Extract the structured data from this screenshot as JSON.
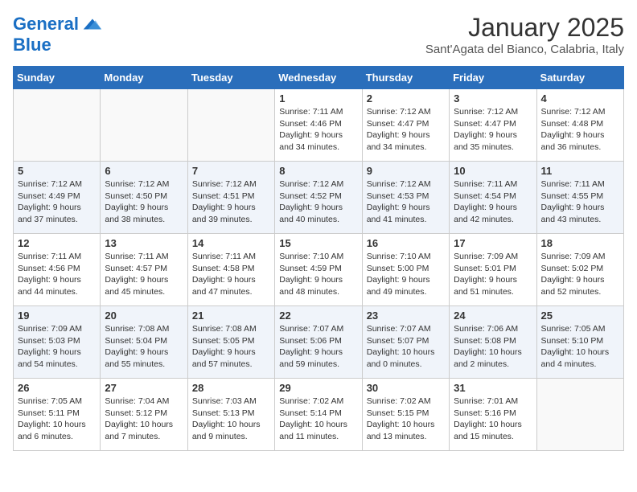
{
  "header": {
    "logo_line1": "General",
    "logo_line2": "Blue",
    "month": "January 2025",
    "location": "Sant'Agata del Bianco, Calabria, Italy"
  },
  "weekdays": [
    "Sunday",
    "Monday",
    "Tuesday",
    "Wednesday",
    "Thursday",
    "Friday",
    "Saturday"
  ],
  "weeks": [
    [
      {
        "day": "",
        "info": ""
      },
      {
        "day": "",
        "info": ""
      },
      {
        "day": "",
        "info": ""
      },
      {
        "day": "1",
        "info": "Sunrise: 7:11 AM\nSunset: 4:46 PM\nDaylight: 9 hours\nand 34 minutes."
      },
      {
        "day": "2",
        "info": "Sunrise: 7:12 AM\nSunset: 4:47 PM\nDaylight: 9 hours\nand 34 minutes."
      },
      {
        "day": "3",
        "info": "Sunrise: 7:12 AM\nSunset: 4:47 PM\nDaylight: 9 hours\nand 35 minutes."
      },
      {
        "day": "4",
        "info": "Sunrise: 7:12 AM\nSunset: 4:48 PM\nDaylight: 9 hours\nand 36 minutes."
      }
    ],
    [
      {
        "day": "5",
        "info": "Sunrise: 7:12 AM\nSunset: 4:49 PM\nDaylight: 9 hours\nand 37 minutes."
      },
      {
        "day": "6",
        "info": "Sunrise: 7:12 AM\nSunset: 4:50 PM\nDaylight: 9 hours\nand 38 minutes."
      },
      {
        "day": "7",
        "info": "Sunrise: 7:12 AM\nSunset: 4:51 PM\nDaylight: 9 hours\nand 39 minutes."
      },
      {
        "day": "8",
        "info": "Sunrise: 7:12 AM\nSunset: 4:52 PM\nDaylight: 9 hours\nand 40 minutes."
      },
      {
        "day": "9",
        "info": "Sunrise: 7:12 AM\nSunset: 4:53 PM\nDaylight: 9 hours\nand 41 minutes."
      },
      {
        "day": "10",
        "info": "Sunrise: 7:11 AM\nSunset: 4:54 PM\nDaylight: 9 hours\nand 42 minutes."
      },
      {
        "day": "11",
        "info": "Sunrise: 7:11 AM\nSunset: 4:55 PM\nDaylight: 9 hours\nand 43 minutes."
      }
    ],
    [
      {
        "day": "12",
        "info": "Sunrise: 7:11 AM\nSunset: 4:56 PM\nDaylight: 9 hours\nand 44 minutes."
      },
      {
        "day": "13",
        "info": "Sunrise: 7:11 AM\nSunset: 4:57 PM\nDaylight: 9 hours\nand 45 minutes."
      },
      {
        "day": "14",
        "info": "Sunrise: 7:11 AM\nSunset: 4:58 PM\nDaylight: 9 hours\nand 47 minutes."
      },
      {
        "day": "15",
        "info": "Sunrise: 7:10 AM\nSunset: 4:59 PM\nDaylight: 9 hours\nand 48 minutes."
      },
      {
        "day": "16",
        "info": "Sunrise: 7:10 AM\nSunset: 5:00 PM\nDaylight: 9 hours\nand 49 minutes."
      },
      {
        "day": "17",
        "info": "Sunrise: 7:09 AM\nSunset: 5:01 PM\nDaylight: 9 hours\nand 51 minutes."
      },
      {
        "day": "18",
        "info": "Sunrise: 7:09 AM\nSunset: 5:02 PM\nDaylight: 9 hours\nand 52 minutes."
      }
    ],
    [
      {
        "day": "19",
        "info": "Sunrise: 7:09 AM\nSunset: 5:03 PM\nDaylight: 9 hours\nand 54 minutes."
      },
      {
        "day": "20",
        "info": "Sunrise: 7:08 AM\nSunset: 5:04 PM\nDaylight: 9 hours\nand 55 minutes."
      },
      {
        "day": "21",
        "info": "Sunrise: 7:08 AM\nSunset: 5:05 PM\nDaylight: 9 hours\nand 57 minutes."
      },
      {
        "day": "22",
        "info": "Sunrise: 7:07 AM\nSunset: 5:06 PM\nDaylight: 9 hours\nand 59 minutes."
      },
      {
        "day": "23",
        "info": "Sunrise: 7:07 AM\nSunset: 5:07 PM\nDaylight: 10 hours\nand 0 minutes."
      },
      {
        "day": "24",
        "info": "Sunrise: 7:06 AM\nSunset: 5:08 PM\nDaylight: 10 hours\nand 2 minutes."
      },
      {
        "day": "25",
        "info": "Sunrise: 7:05 AM\nSunset: 5:10 PM\nDaylight: 10 hours\nand 4 minutes."
      }
    ],
    [
      {
        "day": "26",
        "info": "Sunrise: 7:05 AM\nSunset: 5:11 PM\nDaylight: 10 hours\nand 6 minutes."
      },
      {
        "day": "27",
        "info": "Sunrise: 7:04 AM\nSunset: 5:12 PM\nDaylight: 10 hours\nand 7 minutes."
      },
      {
        "day": "28",
        "info": "Sunrise: 7:03 AM\nSunset: 5:13 PM\nDaylight: 10 hours\nand 9 minutes."
      },
      {
        "day": "29",
        "info": "Sunrise: 7:02 AM\nSunset: 5:14 PM\nDaylight: 10 hours\nand 11 minutes."
      },
      {
        "day": "30",
        "info": "Sunrise: 7:02 AM\nSunset: 5:15 PM\nDaylight: 10 hours\nand 13 minutes."
      },
      {
        "day": "31",
        "info": "Sunrise: 7:01 AM\nSunset: 5:16 PM\nDaylight: 10 hours\nand 15 minutes."
      },
      {
        "day": "",
        "info": ""
      }
    ]
  ]
}
